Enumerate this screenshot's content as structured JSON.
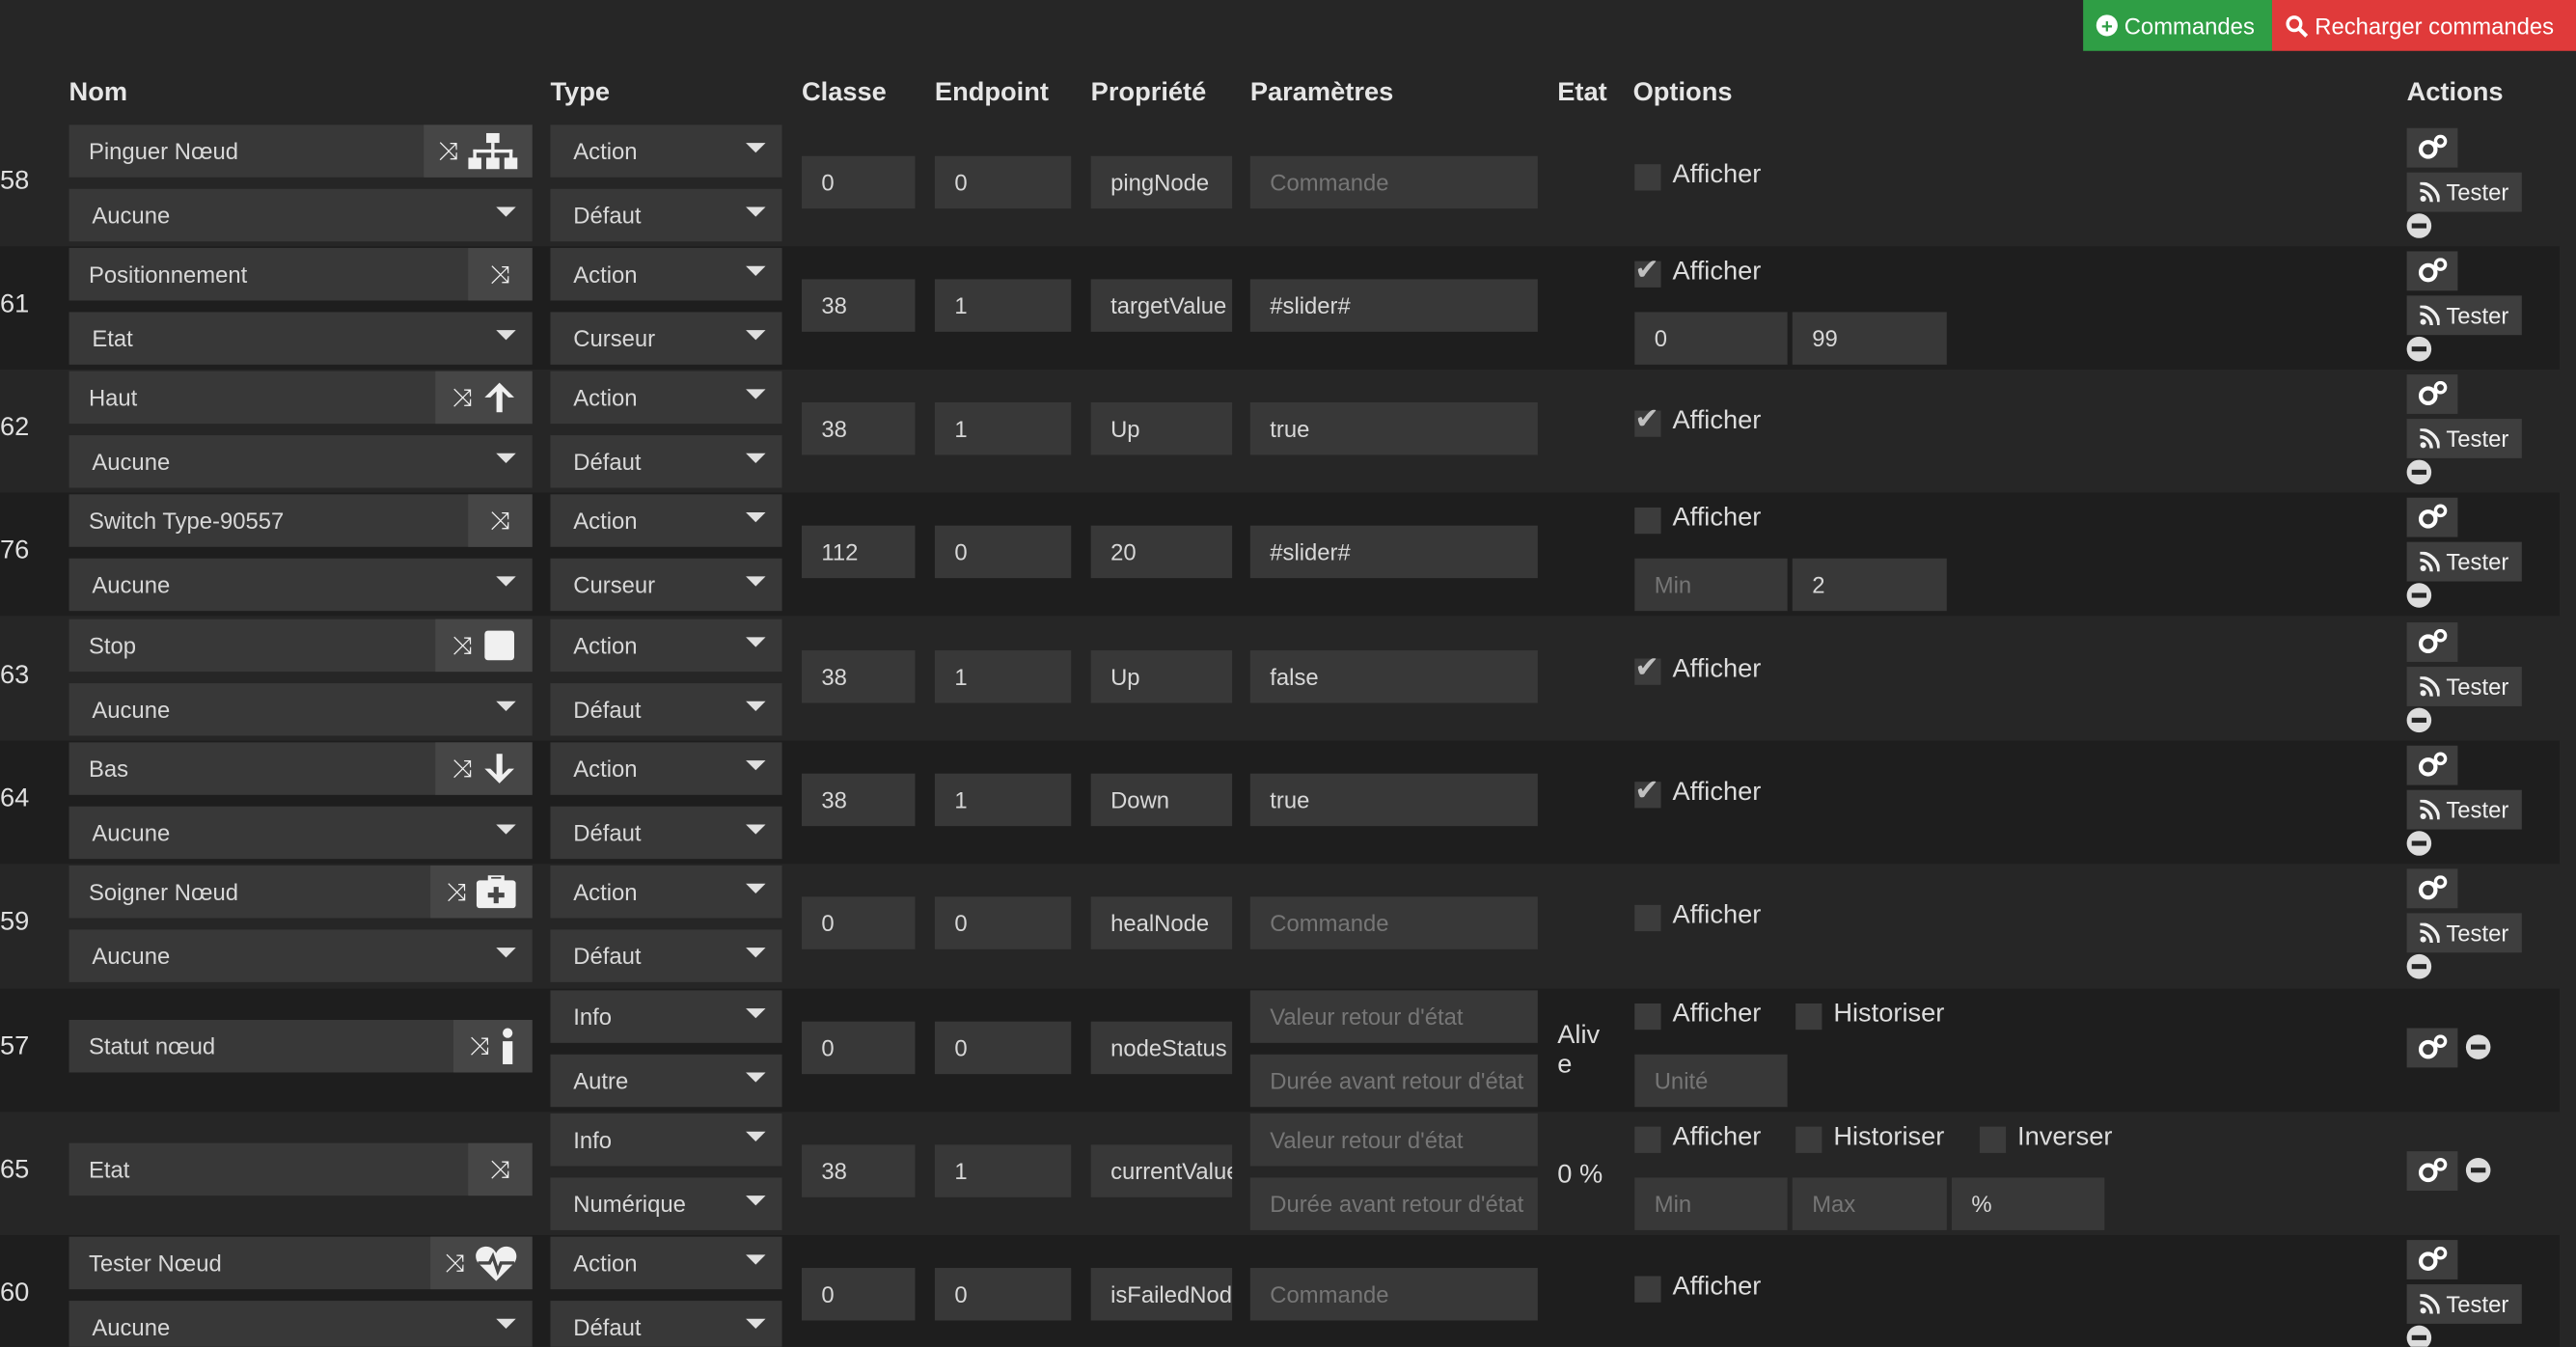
{
  "toolbar": {
    "add_commands_label": "Commandes",
    "reload_commands_label": "Recharger commandes",
    "add_icon": "plus-circle-icon",
    "reload_icon": "search-icon",
    "add_color": "#2f9e45",
    "reload_color": "#e03a3a"
  },
  "headers": {
    "nom": "Nom",
    "type": "Type",
    "classe": "Classe",
    "endpoint": "Endpoint",
    "propriete": "Propriété",
    "parametres": "Paramètres",
    "etat": "Etat",
    "options": "Options",
    "actions": "Actions"
  },
  "actions": {
    "tester_label": "Tester"
  },
  "options": {
    "afficher": "Afficher",
    "historiser": "Historiser",
    "inverser": "Inverser"
  },
  "rows": [
    {
      "id": "58",
      "name": "Pinguer Nœud",
      "icon": "sitemap-icon",
      "sub_select": "Aucune",
      "type": "Action",
      "subtype": "Défaut",
      "classe": "0",
      "endpoint": "0",
      "propriete": "pingNode",
      "parametres": "",
      "parametres_placeholder": "Commande",
      "afficher": false
    },
    {
      "id": "61",
      "name": "Positionnement",
      "icon": "",
      "sub_select": "Etat",
      "type": "Action",
      "subtype": "Curseur",
      "classe": "38",
      "endpoint": "1",
      "propriete": "targetValue",
      "parametres": "#slider#",
      "afficher": true,
      "min": "0",
      "max": "99"
    },
    {
      "id": "62",
      "name": "Haut",
      "icon": "arrow-up-icon",
      "sub_select": "Aucune",
      "type": "Action",
      "subtype": "Défaut",
      "classe": "38",
      "endpoint": "1",
      "propriete": "Up",
      "parametres": "true",
      "afficher": true
    },
    {
      "id": "76",
      "name": "Switch Type-90557",
      "icon": "",
      "sub_select": "Aucune",
      "type": "Action",
      "subtype": "Curseur",
      "classe": "112",
      "endpoint": "0",
      "propriete": "20",
      "parametres": "#slider#",
      "afficher": false,
      "min_placeholder": "Min",
      "max": "2"
    },
    {
      "id": "63",
      "name": "Stop",
      "icon": "square-icon",
      "sub_select": "Aucune",
      "type": "Action",
      "subtype": "Défaut",
      "classe": "38",
      "endpoint": "1",
      "propriete": "Up",
      "parametres": "false",
      "afficher": true
    },
    {
      "id": "64",
      "name": "Bas",
      "icon": "arrow-down-icon",
      "sub_select": "Aucune",
      "type": "Action",
      "subtype": "Défaut",
      "classe": "38",
      "endpoint": "1",
      "propriete": "Down",
      "parametres": "true",
      "afficher": true
    },
    {
      "id": "59",
      "name": "Soigner Nœud",
      "icon": "medkit-icon",
      "sub_select": "Aucune",
      "type": "Action",
      "subtype": "Défaut",
      "classe": "0",
      "endpoint": "0",
      "propriete": "healNode",
      "parametres": "",
      "parametres_placeholder": "Commande",
      "afficher": false
    },
    {
      "id": "57",
      "name": "Statut nœud",
      "icon": "info-icon",
      "type": "Info",
      "subtype": "Autre",
      "classe": "0",
      "endpoint": "0",
      "propriete": "nodeStatus",
      "valeur_placeholder": "Valeur retour d'état",
      "duree_placeholder": "Durée avant retour d'état",
      "etat": "Alive",
      "afficher": false,
      "historiser": false,
      "unite_placeholder": "Unité"
    },
    {
      "id": "65",
      "name": "Etat",
      "icon": "",
      "type": "Info",
      "subtype": "Numérique",
      "classe": "38",
      "endpoint": "1",
      "propriete": "currentValue",
      "valeur_placeholder": "Valeur retour d'état",
      "duree_placeholder": "Durée avant retour d'état",
      "etat": "0 %",
      "afficher": false,
      "historiser": false,
      "inverser": false,
      "min_placeholder": "Min",
      "max_placeholder": "Max",
      "unit": "%"
    },
    {
      "id": "60",
      "name": "Tester Nœud",
      "icon": "heartbeat-icon",
      "sub_select": "Aucune",
      "type": "Action",
      "subtype": "Défaut",
      "classe": "0",
      "endpoint": "0",
      "propriete": "isFailedNode",
      "parametres": "",
      "parametres_placeholder": "Commande",
      "afficher": false
    }
  ]
}
